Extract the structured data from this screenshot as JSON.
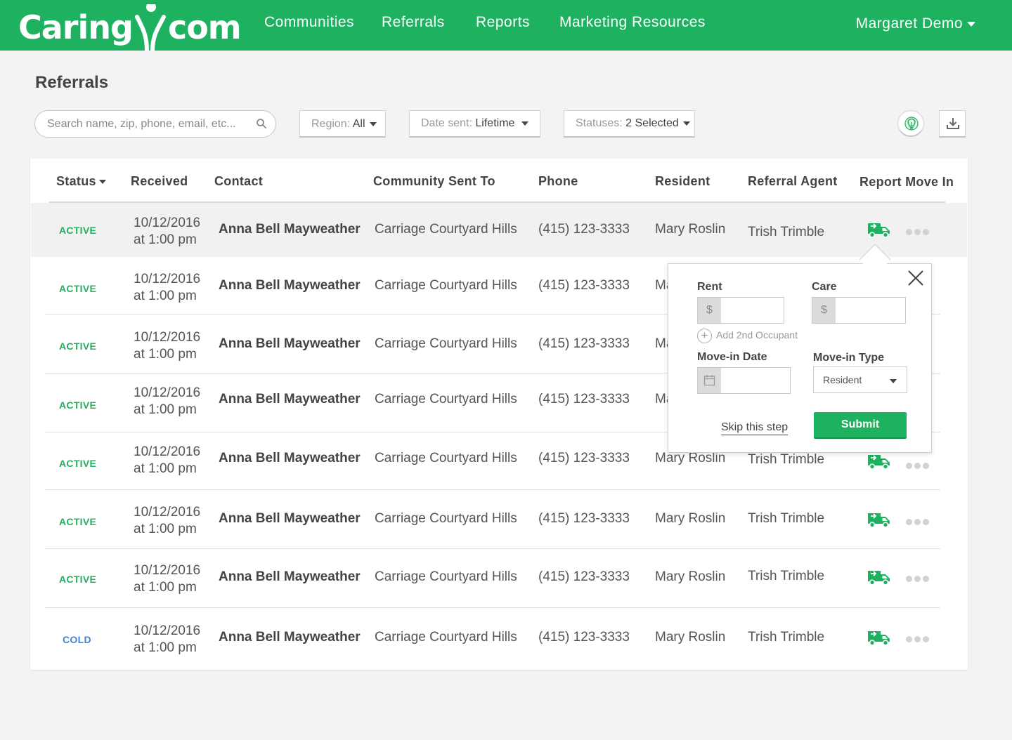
{
  "header": {
    "logo_text_left": "Caring",
    "logo_text_right": "com",
    "nav": [
      "Communities",
      "Referrals",
      "Reports",
      "Marketing Resources"
    ],
    "user": "Margaret Demo"
  },
  "page": {
    "title": "Referrals"
  },
  "filters": {
    "search_placeholder": "Search name, zip, phone, email, etc...",
    "region_label": "Region:",
    "region_value": "All",
    "date_label": "Date sent:",
    "date_value": "Lifetime",
    "status_label": "Statuses:",
    "status_value": "2 Selected",
    "tip_icon": "lightbulb-icon",
    "download_icon": "download-icon"
  },
  "table": {
    "columns": [
      "Status",
      "Received",
      "Contact",
      "Community Sent To",
      "Phone",
      "Resident",
      "Referral Agent",
      "Report Move In"
    ],
    "rows": [
      {
        "status": "ACTIVE",
        "date": "10/12/2016",
        "time": "at 1:00 pm",
        "contact": "Anna Bell Mayweather",
        "community": "Carriage Courtyard Hills",
        "phone": "(415) 123-3333",
        "resident": "Mary Roslin",
        "agent": "Trish Trimble"
      },
      {
        "status": "ACTIVE",
        "date": "10/12/2016",
        "time": "at 1:00 pm",
        "contact": "Anna Bell Mayweather",
        "community": "Carriage Courtyard Hills",
        "phone": "(415) 123-3333",
        "resident": "Ma",
        "agent": ""
      },
      {
        "status": "ACTIVE",
        "date": "10/12/2016",
        "time": "at 1:00 pm",
        "contact": "Anna Bell Mayweather",
        "community": "Carriage Courtyard Hills",
        "phone": "(415) 123-3333",
        "resident": "Ma",
        "agent": ""
      },
      {
        "status": "ACTIVE",
        "date": "10/12/2016",
        "time": "at 1:00 pm",
        "contact": "Anna Bell Mayweather",
        "community": "Carriage Courtyard Hills",
        "phone": "(415) 123-3333",
        "resident": "Ma",
        "agent": ""
      },
      {
        "status": "ACTIVE",
        "date": "10/12/2016",
        "time": "at 1:00 pm",
        "contact": "Anna Bell Mayweather",
        "community": "Carriage Courtyard Hills",
        "phone": "(415) 123-3333",
        "resident": "Mary Roslin",
        "agent": "Trish Trimble"
      },
      {
        "status": "ACTIVE",
        "date": "10/12/2016",
        "time": "at 1:00 pm",
        "contact": "Anna Bell Mayweather",
        "community": "Carriage Courtyard Hills",
        "phone": "(415) 123-3333",
        "resident": "Mary Roslin",
        "agent": "Trish Trimble"
      },
      {
        "status": "ACTIVE",
        "date": "10/12/2016",
        "time": "at 1:00 pm",
        "contact": "Anna Bell Mayweather",
        "community": "Carriage Courtyard Hills",
        "phone": "(415) 123-3333",
        "resident": "Mary Roslin",
        "agent": "Trish Trimble"
      },
      {
        "status": "COLD",
        "date": "10/12/2016",
        "time": "at 1:00 pm",
        "contact": "Anna Bell Mayweather",
        "community": "Carriage Courtyard Hills",
        "phone": "(415) 123-3333",
        "resident": "Mary Roslin",
        "agent": "Trish Trimble"
      }
    ],
    "status_colors": {
      "ACTIVE": "#27ae60",
      "COLD": "#3a87d6"
    },
    "action_icon": "moving-truck-icon",
    "more_icon": "more-dots-icon"
  },
  "move_in_popover": {
    "rent_label": "Rent",
    "care_label": "Care",
    "currency_symbol": "$",
    "add_occupant": "Add 2nd Occupant",
    "date_label": "Move-in Date",
    "type_label": "Move-in Type",
    "type_value": "Resident",
    "skip_label": "Skip this step",
    "submit_label": "Submit"
  },
  "colors": {
    "brand": "#1eb260"
  }
}
